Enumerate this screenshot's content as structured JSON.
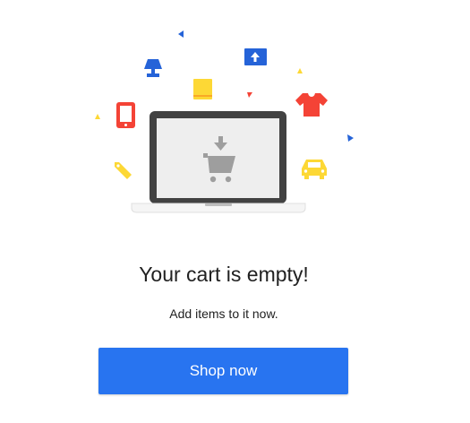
{
  "empty_cart": {
    "title": "Your cart is empty!",
    "subtitle": "Add items to it now.",
    "button_label": "Shop now"
  },
  "colors": {
    "accent": "#2874f0",
    "yellow": "#fdd835",
    "red": "#f44336",
    "blue": "#2563d8",
    "laptop_frame": "#424242",
    "screen": "#eeeeee",
    "cart_icon": "#9e9e9e"
  },
  "illustration_icons": [
    "laptop-icon",
    "shopping-cart-icon",
    "download-arrow-icon",
    "lamp-icon",
    "tv-icon",
    "book-icon",
    "smartphone-icon",
    "tshirt-icon",
    "tag-icon",
    "car-icon",
    "triangle-confetti"
  ]
}
